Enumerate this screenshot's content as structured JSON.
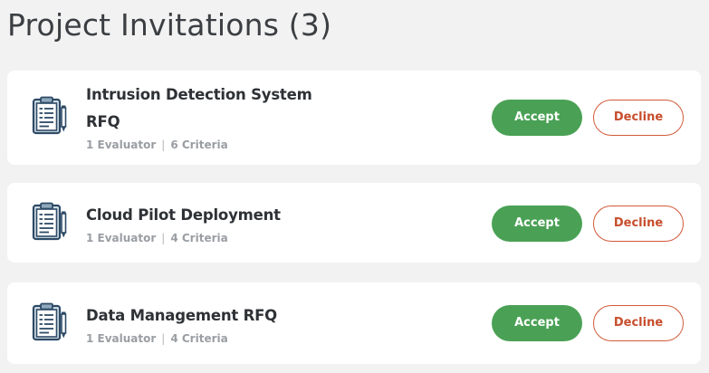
{
  "header": {
    "title": "Project Invitations (3)"
  },
  "invitations": [
    {
      "title_line1": "Intrusion Detection System",
      "title_line2": "RFQ",
      "evaluators": "1 Evaluator",
      "separator": "|",
      "criteria": "6 Criteria",
      "accept_label": "Accept",
      "decline_label": "Decline",
      "icon": "clipboard-icon"
    },
    {
      "title": "Cloud Pilot Deployment",
      "evaluators": "1 Evaluator",
      "separator": "|",
      "criteria": "4 Criteria",
      "accept_label": "Accept",
      "decline_label": "Decline",
      "icon": "clipboard-icon"
    },
    {
      "title": "Data Management RFQ",
      "evaluators": "1 Evaluator",
      "separator": "|",
      "criteria": "4 Criteria",
      "accept_label": "Accept",
      "decline_label": "Decline",
      "icon": "clipboard-icon"
    }
  ],
  "colors": {
    "background": "#f2f2f2",
    "card": "#ffffff",
    "accept": "#4aa155",
    "decline": "#c74d2c",
    "icon_stroke": "#2d4a66",
    "icon_fill": "#d8e2ea"
  }
}
